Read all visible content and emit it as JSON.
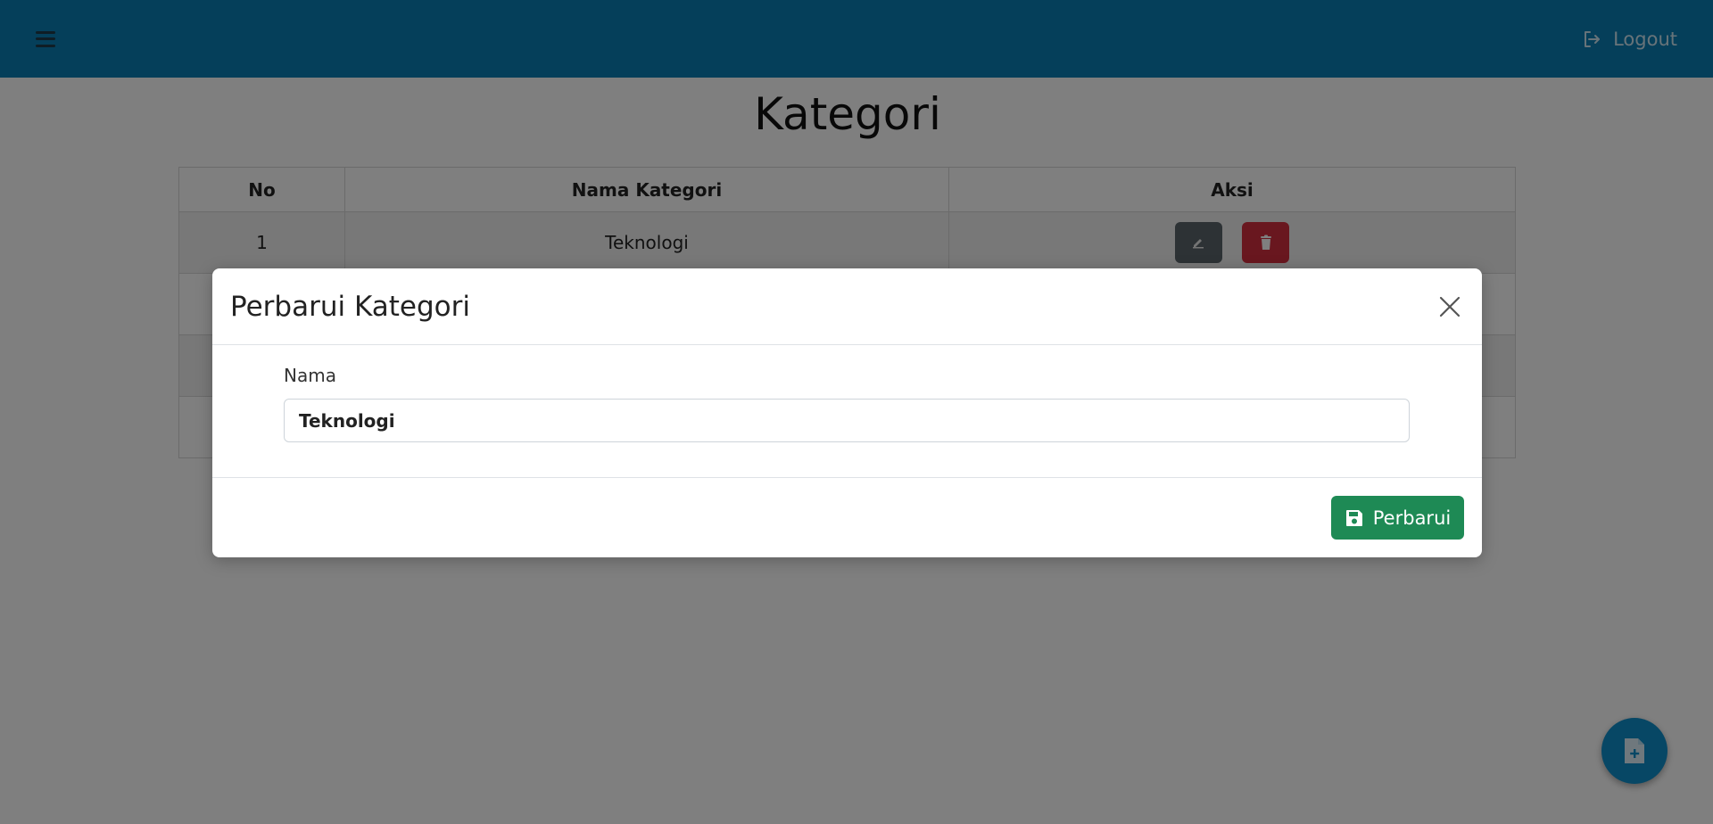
{
  "topbar": {
    "menu_icon": "hamburger-icon",
    "logout_icon": "logout-icon",
    "logout_label": "Logout",
    "color": "#0a7fb5"
  },
  "page": {
    "title": "Kategori"
  },
  "table": {
    "headers": [
      "No",
      "Nama Kategori",
      "Aksi"
    ],
    "rows": [
      {
        "no": "1",
        "name": "Teknologi"
      }
    ]
  },
  "modal": {
    "title": "Perbarui Kategori",
    "close_icon": "close-icon",
    "field_label": "Nama",
    "field_value": "Teknologi",
    "submit_label": "Perbarui",
    "submit_icon": "save-icon",
    "submit_color": "#1e8a55"
  },
  "fab": {
    "icon": "add-file-icon",
    "color": "#0f8ecb"
  }
}
